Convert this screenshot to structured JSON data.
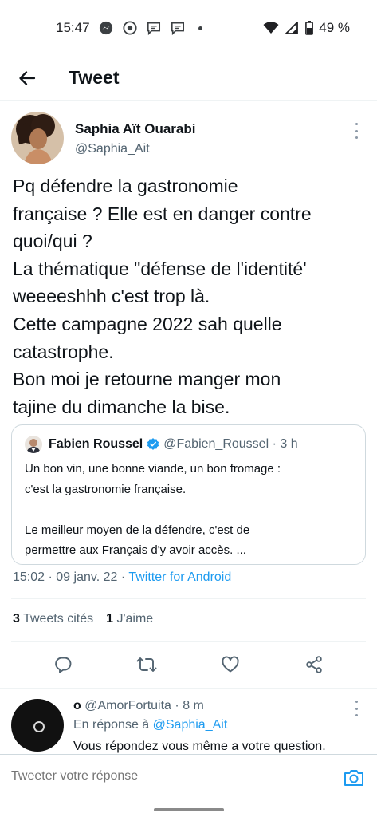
{
  "status_bar": {
    "time": "15:47",
    "battery": "49 %",
    "icons": [
      "messenger-icon",
      "chrome-icon",
      "chat-icon",
      "chat-icon",
      "notification-dot",
      "wifi-icon",
      "signal-icon",
      "battery-icon"
    ]
  },
  "header": {
    "title": "Tweet",
    "back_icon": "arrow-left-icon"
  },
  "tweet": {
    "author_name": "Saphia Aït Ouarabi",
    "author_handle": "@Saphia_Ait",
    "text": "Pq défendre la gastronomie\nfrançaise ? Elle est en danger contre\nquoi/qui ?\nLa thématique \"défense de l'identité'\nweeeeshhh c'est trop là.\nCette campagne 2022 sah quelle\ncatastrophe.\nBon moi je retourne manger mon\ntajine du dimanche la bise.",
    "time": "15:02",
    "date": "09 janv. 22",
    "source": "Twitter for Android"
  },
  "quote": {
    "name": "Fabien Roussel",
    "handle": "@Fabien_Roussel",
    "age": "3 h",
    "text": "Un bon vin, une bonne viande, un bon fromage :\nc'est la gastronomie française.\n\nLe meilleur moyen de la défendre, c'est de\npermettre aux Français d'y avoir accès. ..."
  },
  "stats": {
    "quotes_count": "3",
    "quotes_label": "Tweets cités",
    "likes_count": "1",
    "likes_label": "J'aime"
  },
  "actions": [
    "reply-icon",
    "retweet-icon",
    "like-icon",
    "share-icon"
  ],
  "reply": {
    "name": "o",
    "handle": "@AmorFortuita",
    "age": "8 m",
    "in_reply_prefix": "En réponse à",
    "in_reply_to": "@Saphia_Ait",
    "text": "Vous répondez vous même a votre question."
  },
  "compose": {
    "placeholder": "Tweeter votre réponse"
  },
  "colors": {
    "accent": "#1d9bf0",
    "secondary_text": "#536471",
    "border": "#cfd9de"
  }
}
